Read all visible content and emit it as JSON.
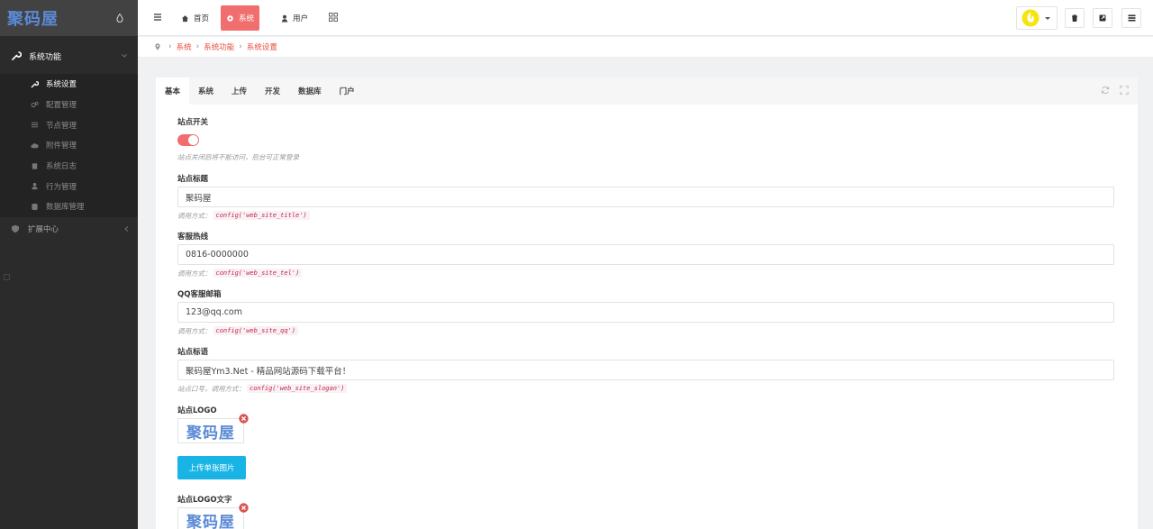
{
  "sidebar": {
    "brand": "聚码屋",
    "group_main": "系统功能",
    "items": [
      {
        "label": "系统设置",
        "icon": "wrench-icon",
        "active": true
      },
      {
        "label": "配置管理",
        "icon": "gears-icon",
        "active": false
      },
      {
        "label": "节点管理",
        "icon": "list-icon",
        "active": false
      },
      {
        "label": "附件管理",
        "icon": "cloud-icon",
        "active": false
      },
      {
        "label": "系统日志",
        "icon": "book-icon",
        "active": false
      },
      {
        "label": "行为管理",
        "icon": "user-icon",
        "active": false
      },
      {
        "label": "数据库管理",
        "icon": "database-icon",
        "active": false
      }
    ],
    "group_ext": "扩展中心"
  },
  "topbar": {
    "nav": [
      {
        "label": "首页",
        "icon": "home-icon",
        "active": false
      },
      {
        "label": "系统",
        "icon": "gear-icon",
        "active": true
      },
      {
        "label": "用户",
        "icon": "user-icon",
        "active": false
      }
    ]
  },
  "breadcrumb": [
    "系统",
    "系统功能",
    "系统设置"
  ],
  "tabs": [
    "基本",
    "系统",
    "上传",
    "开发",
    "数据库",
    "门户"
  ],
  "form": {
    "site_switch": {
      "label": "站点开关",
      "on": true,
      "help": "站点关闭后将不能访问，后台可正常登录"
    },
    "site_title": {
      "label": "站点标题",
      "value": "聚码屋",
      "help_prefix": "调用方式：",
      "code": "config('web_site_title')"
    },
    "hotline": {
      "label": "客服热线",
      "value": "0816-0000000",
      "help_prefix": "调用方式：",
      "code": "config('web_site_tel')"
    },
    "qq_email": {
      "label": "QQ客服邮箱",
      "value": "123@qq.com",
      "help_prefix": "调用方式：",
      "code": "config('web_site_qq')"
    },
    "slogan": {
      "label": "站点标语",
      "value": "聚码屋Ym3.Net - 精品网站源码下载平台！",
      "help_prefix": "站点口号，调用方式：",
      "code": "config('web_site_slogan')"
    },
    "logo": {
      "label": "站点LOGO",
      "image_text": "聚码屋",
      "upload_label": "上传单张图片"
    },
    "logo_text": {
      "label": "站点LOGO文字",
      "image_text": "聚码屋"
    }
  },
  "colors": {
    "accent": "#f06e6e",
    "brand_blue": "#5b8ad6",
    "upload": "#19b4e6",
    "sidebar": "#2b2b2b"
  }
}
